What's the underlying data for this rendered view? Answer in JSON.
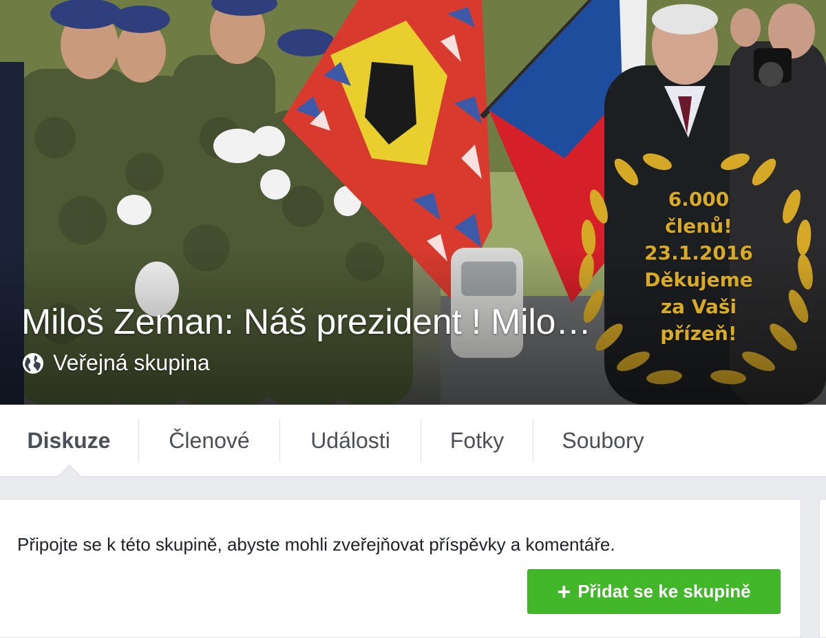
{
  "cover": {
    "title": "Miloš Zeman: Náš prezident ! Milo…",
    "privacy_label": "Veřejná skupina",
    "privacy_icon": "globe-icon",
    "badge_lines": [
      "6.000",
      "členů!",
      "23.1.2016",
      "Děkujeme",
      "za Vaši",
      "přízeň!"
    ]
  },
  "tabs": [
    {
      "label": "Diskuze",
      "active": true
    },
    {
      "label": "Členové",
      "active": false
    },
    {
      "label": "Události",
      "active": false
    },
    {
      "label": "Fotky",
      "active": false
    },
    {
      "label": "Soubory",
      "active": false
    }
  ],
  "join": {
    "message": "Připojte se k této skupině, abyste mohli zveřejňovat příspěvky a komentáře.",
    "button_label": "Přidat se ke skupině",
    "button_icon": "plus-icon"
  },
  "colors": {
    "accent_green": "#42b72a",
    "badge_gold": "#d8ab22",
    "page_bg": "#e9ebee"
  }
}
